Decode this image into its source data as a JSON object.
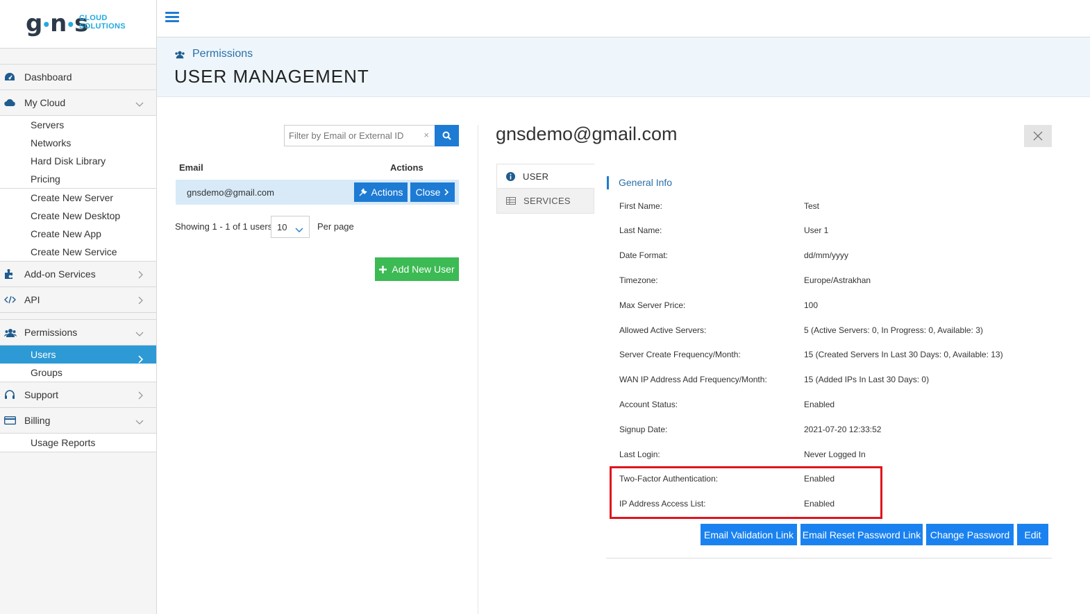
{
  "logo": {
    "main": "gns",
    "line1": "CLOUD",
    "line2": "SOLUTIONS"
  },
  "sidebar": {
    "dashboard": "Dashboard",
    "my_cloud": "My Cloud",
    "my_cloud_items": [
      "Servers",
      "Networks",
      "Hard Disk Library",
      "Pricing"
    ],
    "create_items": [
      "Create New Server",
      "Create New Desktop",
      "Create New App",
      "Create New Service"
    ],
    "addon": "Add-on Services",
    "api": "API",
    "permissions": "Permissions",
    "users": "Users",
    "groups": "Groups",
    "support": "Support",
    "billing": "Billing",
    "usage_reports": "Usage Reports"
  },
  "header": {
    "breadcrumb": "Permissions",
    "title": "USER MANAGEMENT"
  },
  "users_list": {
    "filter_placeholder": "Filter by Email or External ID",
    "clear": "×",
    "col_email": "Email",
    "col_actions": "Actions",
    "row_email": "gnsdemo@gmail.com",
    "actions_btn": "Actions",
    "close_btn": "Close",
    "showing": "Showing 1 - 1 of 1 users,",
    "per_page_value": "10",
    "per_page_label": "Per page",
    "add_user": "Add New User"
  },
  "detail": {
    "email": "gnsdemo@gmail.com",
    "tab_user": "USER",
    "tab_services": "SERVICES",
    "section": "General Info",
    "fields": [
      {
        "label": "First Name:",
        "value": "Test"
      },
      {
        "label": "Last Name:",
        "value": "User 1"
      },
      {
        "label": "Date Format:",
        "value": "dd/mm/yyyy"
      },
      {
        "label": "Timezone:",
        "value": "Europe/Astrakhan"
      },
      {
        "label": "Max Server Price:",
        "value": "100"
      },
      {
        "label": "Allowed Active Servers:",
        "value": "5 (Active Servers: 0, In Progress: 0, Available: 3)"
      },
      {
        "label": "Server Create Frequency/Month:",
        "value": "15 (Created Servers In Last 30 Days: 0, Available: 13)"
      },
      {
        "label": "WAN IP Address Add Frequency/Month:",
        "value": "15 (Added IPs In Last 30 Days: 0)"
      },
      {
        "label": "Account Status:",
        "value": "Enabled"
      },
      {
        "label": "Signup Date:",
        "value": "2021-07-20 12:33:52"
      },
      {
        "label": "Last Login:",
        "value": "Never Logged In"
      },
      {
        "label": "Two-Factor Authentication:",
        "value": "Enabled"
      },
      {
        "label": "IP Address Access List:",
        "value": "Enabled"
      }
    ],
    "buttons": {
      "email_validation": "Email Validation Link",
      "email_reset": "Email Reset Password Link",
      "change_password": "Change Password",
      "edit": "Edit"
    }
  },
  "colors": {
    "primary": "#1d7bd4",
    "success": "#3cba54",
    "highlight": "#e0141e",
    "active_nav": "#2d9ad6"
  }
}
